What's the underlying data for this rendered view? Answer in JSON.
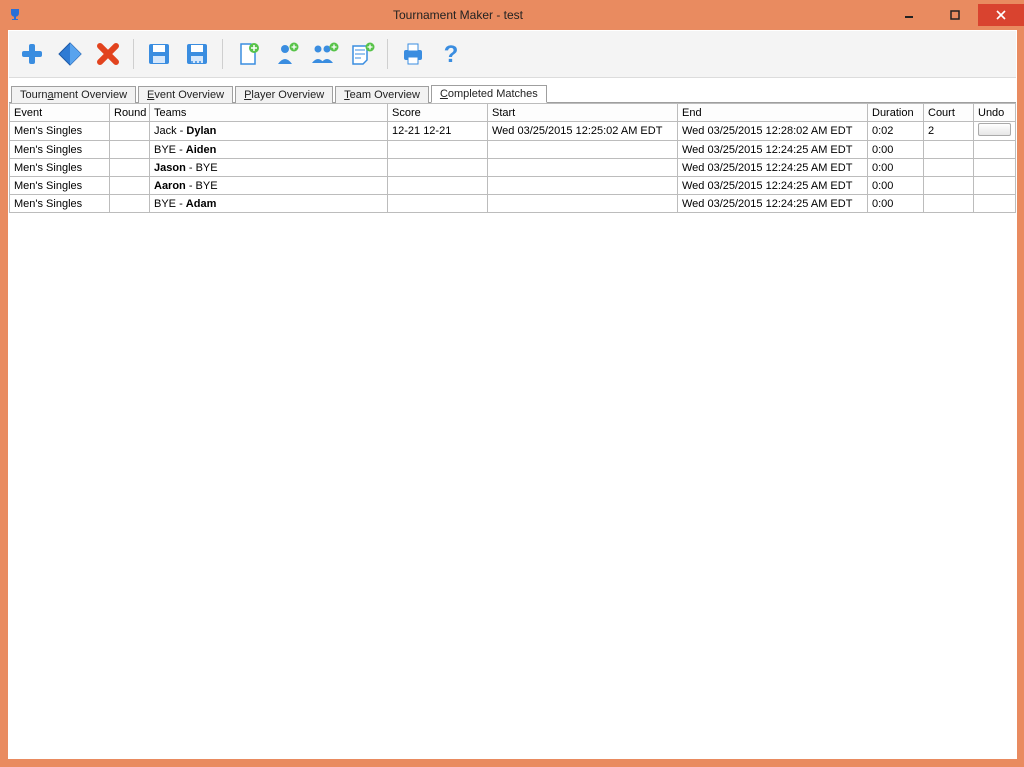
{
  "window_title": "Tournament Maker - test",
  "tabs": [
    {
      "label_pre": "Tourn",
      "label_u": "a",
      "label_post": "ment Overview"
    },
    {
      "label_pre": "",
      "label_u": "E",
      "label_post": "vent Overview"
    },
    {
      "label_pre": "",
      "label_u": "P",
      "label_post": "layer Overview"
    },
    {
      "label_pre": "",
      "label_u": "T",
      "label_post": "eam Overview"
    },
    {
      "label_pre": "",
      "label_u": "C",
      "label_post": "ompleted Matches"
    }
  ],
  "columns": {
    "event": "Event",
    "round": "Round",
    "teams": "Teams",
    "score": "Score",
    "start": "Start",
    "end": "End",
    "duration": "Duration",
    "court": "Court",
    "undo": "Undo"
  },
  "rows": [
    {
      "event": "Men's Singles",
      "round": "",
      "team_a": "Jack",
      "team_b": "Dylan",
      "winner_side": "b",
      "score": "12-21 12-21",
      "start": "Wed 03/25/2015 12:25:02 AM EDT",
      "end": "Wed 03/25/2015 12:28:02 AM EDT",
      "duration": "0:02",
      "court": "2",
      "has_undo": true
    },
    {
      "event": "Men's Singles",
      "round": "",
      "team_a": "BYE",
      "team_b": "Aiden",
      "winner_side": "b",
      "score": "",
      "start": "",
      "end": "Wed 03/25/2015 12:24:25 AM EDT",
      "duration": "0:00",
      "court": "",
      "has_undo": false
    },
    {
      "event": "Men's Singles",
      "round": "",
      "team_a": "Jason",
      "team_b": "BYE",
      "winner_side": "a",
      "score": "",
      "start": "",
      "end": "Wed 03/25/2015 12:24:25 AM EDT",
      "duration": "0:00",
      "court": "",
      "has_undo": false
    },
    {
      "event": "Men's Singles",
      "round": "",
      "team_a": "Aaron",
      "team_b": "BYE",
      "winner_side": "a",
      "score": "",
      "start": "",
      "end": "Wed 03/25/2015 12:24:25 AM EDT",
      "duration": "0:00",
      "court": "",
      "has_undo": false
    },
    {
      "event": "Men's Singles",
      "round": "",
      "team_a": "BYE",
      "team_b": "Adam",
      "winner_side": "b",
      "score": "",
      "start": "",
      "end": "Wed 03/25/2015 12:24:25 AM EDT",
      "duration": "0:00",
      "court": "",
      "has_undo": false
    }
  ],
  "toolbar_icons": [
    "new-icon",
    "bracket-icon",
    "delete-icon",
    "sep",
    "save-icon",
    "save-as-icon",
    "sep",
    "add-event-icon",
    "add-player-icon",
    "add-team-icon",
    "add-note-icon",
    "sep",
    "print-icon",
    "help-icon"
  ]
}
